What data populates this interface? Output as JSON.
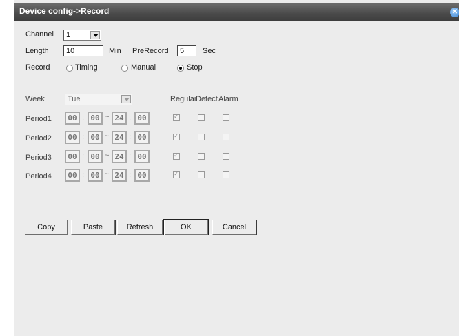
{
  "window": {
    "title": "Device config->Record",
    "close_label": "✕"
  },
  "form": {
    "channel_label": "Channel",
    "channel_value": "1",
    "length_label": "Length",
    "length_value": "10",
    "min_label": "Min",
    "prerecord_label": "PreRecord",
    "prerecord_value": "5",
    "sec_label": "Sec",
    "record_label": "Record",
    "record_options": [
      "Timing",
      "Manual",
      "Stop"
    ],
    "record_selected": "Stop"
  },
  "schedule": {
    "week_label": "Week",
    "week_value": "Tue",
    "col_regular": "Regular",
    "col_detect": "Detect",
    "col_alarm": "Alarm",
    "periods": [
      {
        "label": "Period1",
        "start_h": "00",
        "start_m": "00",
        "end_h": "24",
        "end_m": "00",
        "regular": true,
        "detect": false,
        "alarm": false
      },
      {
        "label": "Period2",
        "start_h": "00",
        "start_m": "00",
        "end_h": "24",
        "end_m": "00",
        "regular": true,
        "detect": false,
        "alarm": false
      },
      {
        "label": "Period3",
        "start_h": "00",
        "start_m": "00",
        "end_h": "24",
        "end_m": "00",
        "regular": true,
        "detect": false,
        "alarm": false
      },
      {
        "label": "Period4",
        "start_h": "00",
        "start_m": "00",
        "end_h": "24",
        "end_m": "00",
        "regular": true,
        "detect": false,
        "alarm": false
      }
    ],
    "colon": ":",
    "dash": "~"
  },
  "buttons": {
    "copy": "Copy",
    "paste": "Paste",
    "refresh": "Refresh",
    "ok": "OK",
    "cancel": "Cancel"
  }
}
